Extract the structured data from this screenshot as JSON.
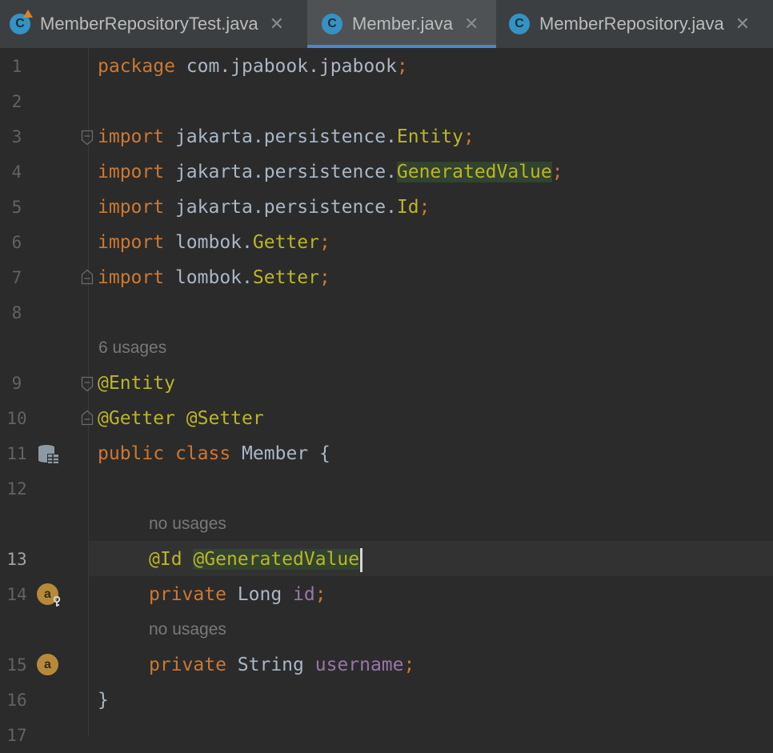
{
  "tabs": [
    {
      "label": "MemberRepositoryTest.java",
      "icon": "class-test-icon",
      "active": false
    },
    {
      "label": "Member.java",
      "icon": "class-icon",
      "active": true
    },
    {
      "label": "MemberRepository.java",
      "icon": "class-icon",
      "active": false
    }
  ],
  "tab_icon_letter": "C",
  "close_glyph": "✕",
  "line_numbers": [
    "1",
    "2",
    "3",
    "4",
    "5",
    "6",
    "7",
    "8",
    "9",
    "10",
    "11",
    "12",
    "13",
    "14",
    "15",
    "16",
    "17"
  ],
  "hints": {
    "class_usages": "6 usages",
    "id_usages": "no usages",
    "username_usages": "no usages"
  },
  "code": {
    "l1": {
      "kw": "package",
      "rest": " com.jpabook.jpabook",
      "semi": ";"
    },
    "l3": {
      "kw": "import",
      "pkg": " jakarta.persistence.",
      "cls": "Entity",
      "semi": ";"
    },
    "l4": {
      "kw": "import",
      "pkg": " jakarta.persistence.",
      "cls": "GeneratedValue",
      "semi": ";"
    },
    "l5": {
      "kw": "import",
      "pkg": " jakarta.persistence.",
      "cls": "Id",
      "semi": ";"
    },
    "l6": {
      "kw": "import",
      "pkg": " lombok.",
      "cls": "Getter",
      "semi": ";"
    },
    "l7": {
      "kw": "import",
      "pkg": " lombok.",
      "cls": "Setter",
      "semi": ";"
    },
    "l9": {
      "ann": "@Entity"
    },
    "l10": {
      "ann1": "@Getter",
      "ann2": "@Setter"
    },
    "l11": {
      "kw1": "public",
      "kw2": "class",
      "name": " Member {"
    },
    "l13": {
      "ann1": "@Id",
      "ann2": "@GeneratedValue"
    },
    "l14": {
      "kw": "private",
      "type": " Long ",
      "field": "id",
      "semi": ";"
    },
    "l15": {
      "kw": "private",
      "type": " String ",
      "field": "username",
      "semi": ";"
    },
    "l16": {
      "text": "}"
    }
  },
  "gutter_icons": {
    "line11": "database-table-icon",
    "line14": "field-key-icon",
    "line15": "field-icon",
    "field_letter": "a"
  },
  "colors": {
    "background": "#2b2b2b",
    "keyword": "#cc7832",
    "annotation": "#bbb529",
    "field": "#9876aa",
    "text": "#a9b7c6",
    "active_tab_underline": "#4a88c7"
  }
}
